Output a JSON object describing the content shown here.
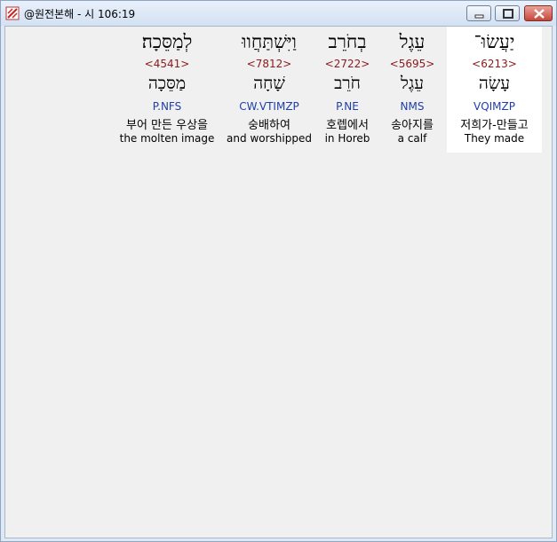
{
  "window": {
    "title": "@원전본해 - 시 106:19",
    "controls": [
      "minimize-icon",
      "maximize-icon",
      "close-icon"
    ]
  },
  "words": [
    {
      "hebrew": "לְמַסֵּכָה׃",
      "strong": "<4541>",
      "lemma": "מַסֵּכָה",
      "parse": "P.NFS",
      "korean": "부어 만든 우상을",
      "english": "the molten image"
    },
    {
      "hebrew": "וַיִּשְׁתַּחֲווּ",
      "strong": "<7812>",
      "lemma": "שָׁחָה",
      "parse": "CW.VTIMZP",
      "korean": "숭배하여",
      "english": "and worshipped"
    },
    {
      "hebrew": "בְחֹרֵב",
      "strong": "<2722>",
      "lemma": "חֹרֵב",
      "parse": "P.NE",
      "korean": "호렙에서",
      "english": "in Horeb"
    },
    {
      "hebrew": "עֵגֶל",
      "strong": "<5695>",
      "lemma": "עֵגֶל",
      "parse": "NMS",
      "korean": "송아지를",
      "english": "a calf"
    },
    {
      "hebrew": "יַעֲשׂוּ־",
      "strong": "<6213>",
      "lemma": "עָשָׂה",
      "parse": "VQIMZP",
      "korean": "저희가-만들고",
      "english": "They made"
    }
  ],
  "colors": {
    "strong_number": "#8b1a1a",
    "parse_code": "#1f3fa8",
    "background": "#f0f0f0",
    "selected_column": "#ffffff"
  }
}
